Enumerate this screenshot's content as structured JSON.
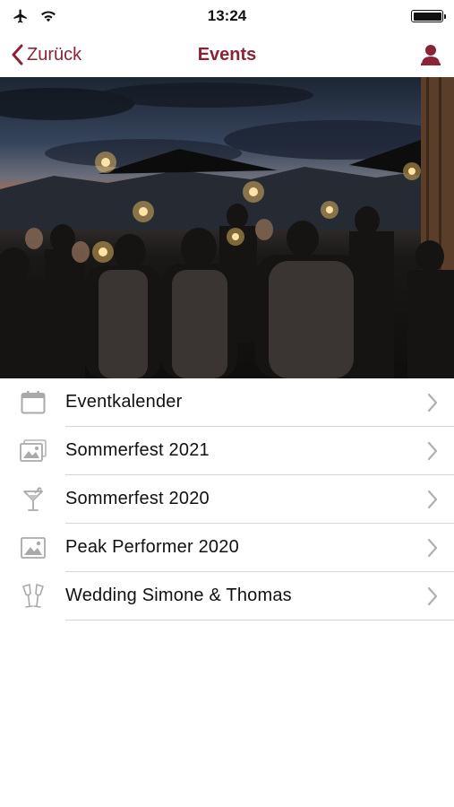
{
  "status": {
    "time": "13:24"
  },
  "nav": {
    "back_label": "Zurück",
    "title": "Events"
  },
  "colors": {
    "accent": "#8b2336",
    "separator": "#d6d6d6",
    "icon": "#a9a9a9"
  },
  "hero": {
    "image": "evening party photo with sparklers"
  },
  "menu": {
    "items": [
      {
        "label": "Eventkalender",
        "icon": "calendar-icon"
      },
      {
        "label": "Sommerfest 2021",
        "icon": "photo-gallery-icon"
      },
      {
        "label": "Sommerfest 2020",
        "icon": "cocktail-glass-icon"
      },
      {
        "label": "Peak Performer 2020",
        "icon": "photo-icon"
      },
      {
        "label": "Wedding Simone & Thomas",
        "icon": "champagne-glasses-icon"
      }
    ]
  }
}
